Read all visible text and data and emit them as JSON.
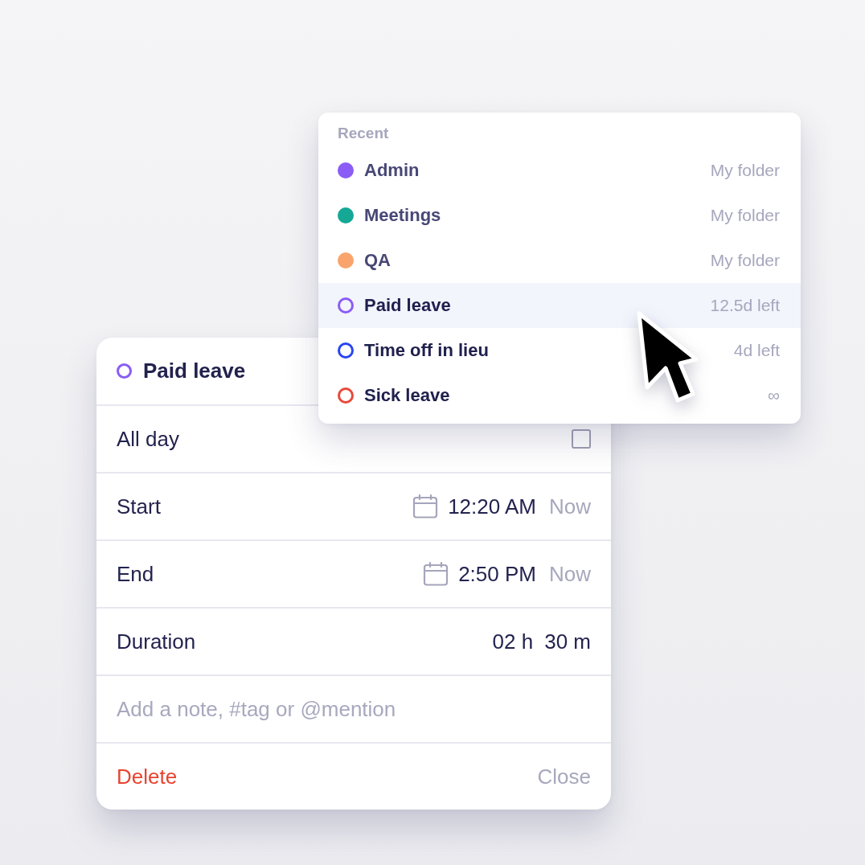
{
  "menu": {
    "heading": "Recent",
    "items": [
      {
        "kind": "folder",
        "label": "Admin",
        "detail": "My folder",
        "color": "#8b5cf6",
        "selected": false
      },
      {
        "kind": "folder",
        "label": "Meetings",
        "detail": "My folder",
        "color": "#14a895",
        "selected": false
      },
      {
        "kind": "folder",
        "label": "QA",
        "detail": "My folder",
        "color": "#f8a46c",
        "selected": false
      },
      {
        "kind": "leave",
        "label": "Paid leave",
        "detail": "12.5d left",
        "color": "#8b5cf6",
        "selected": true
      },
      {
        "kind": "leave",
        "label": "Time off in lieu",
        "detail": "4d left",
        "color": "#2a44f0",
        "selected": false
      },
      {
        "kind": "leave",
        "label": "Sick leave",
        "detail": "∞",
        "color": "#e8493a",
        "selected": false
      }
    ]
  },
  "card": {
    "leave_type": {
      "label": "Paid leave",
      "color": "#8b5cf6"
    },
    "all_day": {
      "label": "All day",
      "checked": false
    },
    "start": {
      "label": "Start",
      "time": "12:20 AM",
      "now": "Now"
    },
    "end": {
      "label": "End",
      "time": "2:50 PM",
      "now": "Now"
    },
    "duration": {
      "label": "Duration",
      "hours": "02 h",
      "minutes": "30 m"
    },
    "note": {
      "placeholder": "Add a note, #tag or @mention"
    },
    "delete": "Delete",
    "close": "Close"
  }
}
